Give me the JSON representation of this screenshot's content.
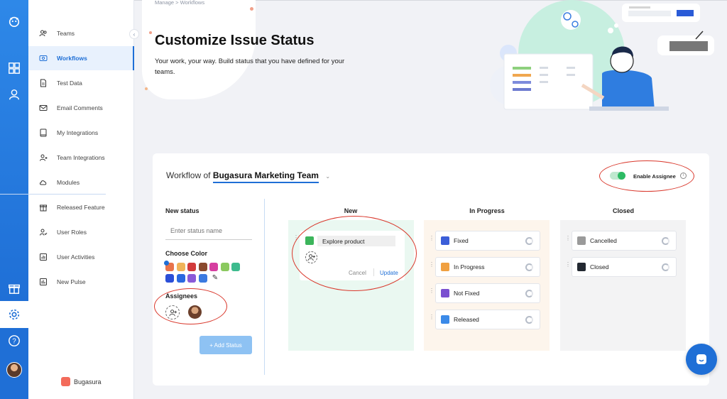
{
  "breadcrumb": "Manage > Workflows",
  "header": {
    "title": "Customize Issue Status",
    "subtitle": "Your work, your way. Build status that you have defined for your teams."
  },
  "sidebar": {
    "items": [
      {
        "label": "Teams",
        "icon": "users-icon"
      },
      {
        "label": "Workflows",
        "icon": "workflow-icon",
        "active": true
      },
      {
        "label": "Test Data",
        "icon": "document-icon"
      },
      {
        "label": "Email Comments",
        "icon": "mail-icon"
      },
      {
        "label": "My Integrations",
        "icon": "book-icon"
      },
      {
        "label": "Team Integrations",
        "icon": "team-integrations-icon"
      },
      {
        "label": "Modules",
        "icon": "modules-icon"
      },
      {
        "label": "Released Feature",
        "icon": "gift-icon"
      },
      {
        "label": "User Roles",
        "icon": "user-role-icon"
      },
      {
        "label": "User Activities",
        "icon": "chart-icon"
      },
      {
        "label": "New Pulse",
        "icon": "pulse-icon"
      }
    ],
    "brand": "Bugasura"
  },
  "workflow": {
    "prefix": "Workflow of",
    "team": "Bugasura Marketing Team",
    "enable_assignee_label": "Enable Assignee",
    "enable_assignee_on": true
  },
  "new_status": {
    "title": "New status",
    "placeholder": "Enter status name",
    "choose_color_label": "Choose Color",
    "colors": [
      "#e8734a",
      "#f0b45a",
      "#d23b3b",
      "#8a4a2e",
      "#d63ea0",
      "#8bc95f",
      "#3dbb8e",
      "#2b4fd8",
      "#2a68e0",
      "#8a5ad8",
      "#3b7ae0"
    ],
    "selected_color": "#e8734a",
    "assignees_label": "Assignees",
    "add_button": "+ Add Status"
  },
  "columns": [
    {
      "title": "New",
      "bg": "#eaf8f1",
      "editing": {
        "value": "Explore product",
        "color": "#3cb55b",
        "cancel": "Cancel",
        "update": "Update"
      },
      "statuses": []
    },
    {
      "title": "In Progress",
      "bg": "#fdf5ec",
      "statuses": [
        {
          "label": "Fixed",
          "color": "#3b5ed8"
        },
        {
          "label": "In Progress",
          "color": "#f0a040"
        },
        {
          "label": "Not Fixed",
          "color": "#7a4fd0"
        },
        {
          "label": "Released",
          "color": "#3b8ae8"
        }
      ]
    },
    {
      "title": "Closed",
      "bg": "#f3f3f4",
      "statuses": [
        {
          "label": "Cancelled",
          "color": "#9a9a9a"
        },
        {
          "label": "Closed",
          "color": "#222831"
        }
      ]
    }
  ],
  "colors": {
    "primary": "#1f6fd6",
    "annotation": "#d9372b",
    "toggle_on": "#2dbb64"
  }
}
